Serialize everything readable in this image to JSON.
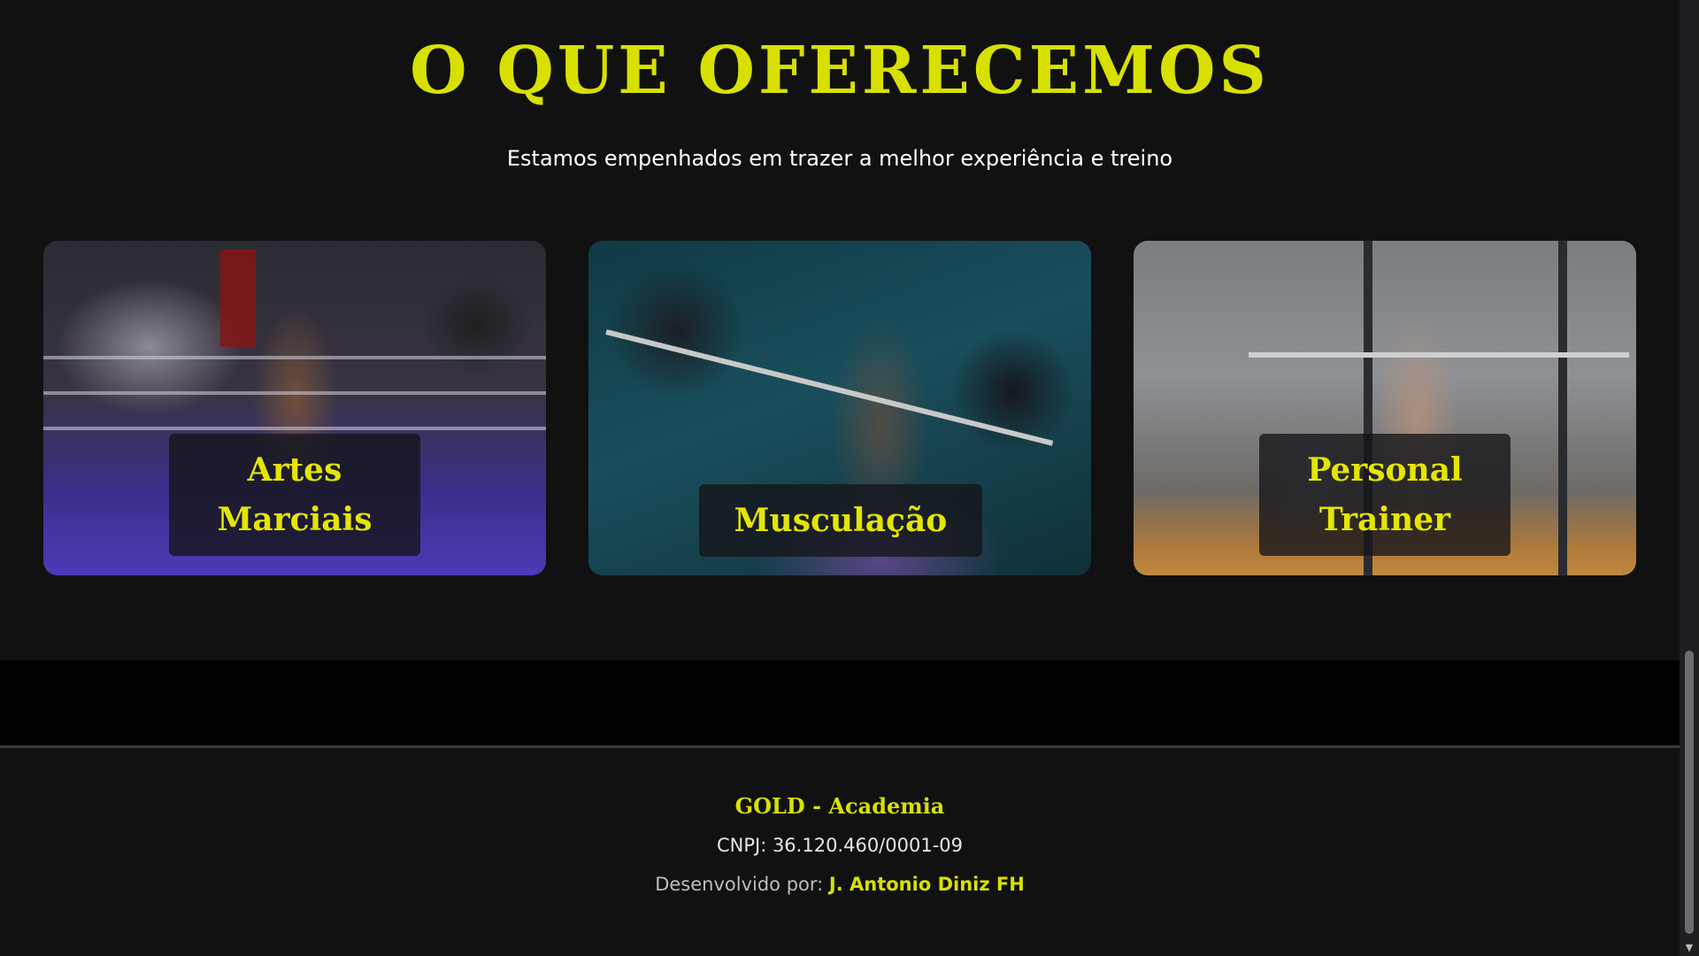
{
  "section": {
    "title": "O QUE OFERECEMOS",
    "subtitle": "Estamos empenhados em trazer a melhor experiência e treino"
  },
  "cards": [
    {
      "label_line1": "Artes",
      "label_line2": "Marciais"
    },
    {
      "label_line1": "Musculação"
    },
    {
      "label_line1": "Personal",
      "label_line2": "Trainer"
    }
  ],
  "footer": {
    "brand": "GOLD - Academia",
    "cnpj": "CNPJ: 36.120.460/0001-09",
    "dev_prefix": "Desenvolvido por:",
    "dev_name": "J. Antonio Diniz FH"
  },
  "colors": {
    "accent": "#d8e000",
    "background": "#111111",
    "band": "#000000"
  },
  "icons": {
    "scroll_down": "chevron-down-icon"
  }
}
